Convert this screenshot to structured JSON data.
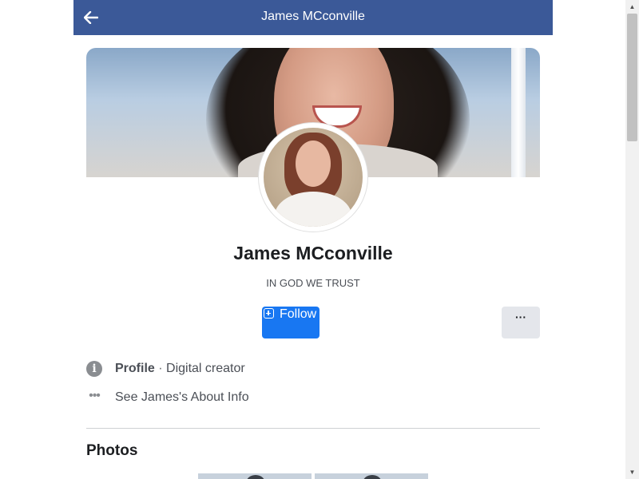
{
  "topbar": {
    "title": "James MCconville",
    "back_icon": "arrow-left-icon"
  },
  "profile": {
    "name": "James MCconville",
    "bio": "IN GOD WE TRUST"
  },
  "actions": {
    "follow_label": "Follow",
    "more_label": "···"
  },
  "info": {
    "profile_label": "Profile",
    "separator": " · ",
    "category": "Digital creator",
    "about_link": "See James's About Info"
  },
  "photos": {
    "section_title": "Photos"
  },
  "colors": {
    "header_bg": "#3b5998",
    "follow_bg": "#1877f2",
    "more_bg": "#e4e6eb"
  }
}
